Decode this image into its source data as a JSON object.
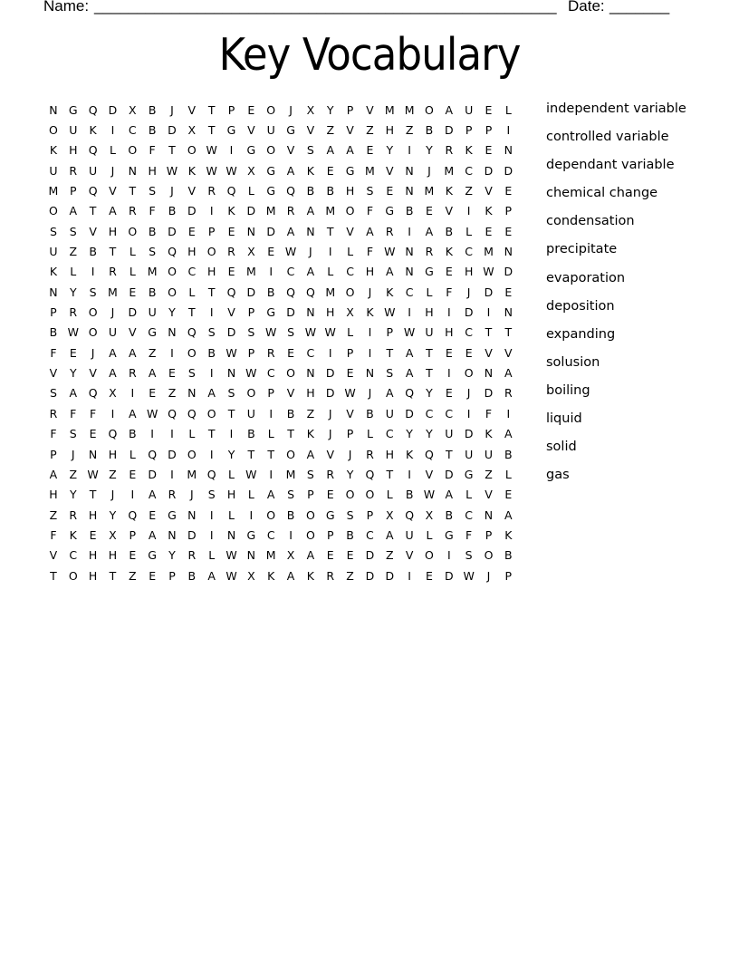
{
  "header": {
    "name_label": "Name:",
    "name_blank": "______________________________________________________",
    "date_label": "Date:",
    "date_blank": "_______"
  },
  "title": "Key Vocabulary",
  "grid": [
    "NGQDXBJVTPEOJXYPVMMOAUEL",
    "OUKICBDXTGVUGVZVZHZBDPPI",
    "KHQLOFTOWIGOVSAAEYIYRKEN",
    "URUJNHWKWWXGAKEGMVNJMCDD",
    "MPQVTSJVRQLGQBBHSENMKZVE",
    "OATARFBDIKDMRAMOFGBEVIKP",
    "SSVHOBDEPENDANTVARIABLEE",
    "UZBTLSQHORXEWJILFWNRKCMN",
    "KLIRLMOCHEMICALCHANGEHWD",
    "NYSMEBOLTQDBQQMOJKCLFJDE",
    "PROJDUYTIVPGDNHXKWIHIDIN",
    "BWOUVGNQSDSWSWWLIPWUHCTT",
    "FEJAAZIOBWPRECIPITATEEVV",
    "VYVARAESINWCONDENSATIONA",
    "SAQXIEZNASOPVHDWJAQYEJDR",
    "RFFIAWQQOTUIBZJVBUDCCIFI",
    "FSEQBIILTIBLTKJPLCYYUDKA",
    "PJNHLQDOIYTTOAVJRHKQTUUB",
    "AZWZEDIMQLWIMSRYQTIVDGZL",
    "HYTJIARJSHLASPEOOLBWALVE",
    "ZRHYQEGNILIOBOGSPXQXBCNA",
    "FKEXPANDINGCIOPBCAULGFPK",
    "VCHHEGYRLWNMXAEEDZVOISOB",
    "TOHTZEPBAWXKAKRZDDIEDWJP"
  ],
  "words": [
    "independent variable",
    "controlled variable",
    "dependant variable",
    "chemical change",
    "condensation",
    "precipitate",
    "evaporation",
    "deposition",
    "expanding",
    "solusion",
    "boiling",
    "liquid",
    "solid",
    "gas"
  ]
}
